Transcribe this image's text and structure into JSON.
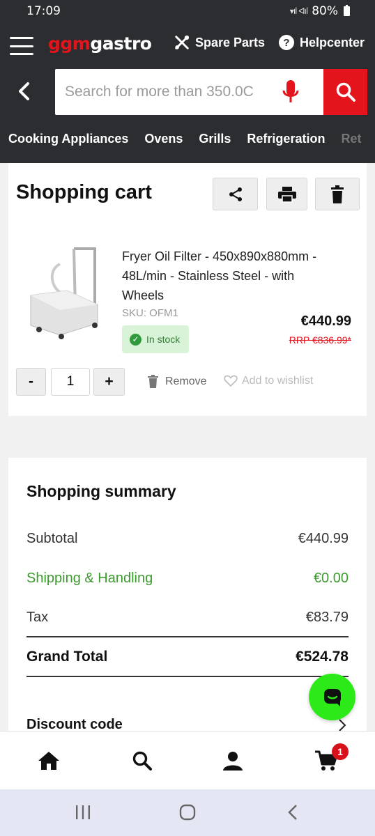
{
  "status_bar": {
    "time": "17:09",
    "battery": "80%"
  },
  "header": {
    "logo_part1": "ggm",
    "logo_part2": "gastro",
    "spare_parts": "Spare Parts",
    "helpcenter": "Helpcenter",
    "search_placeholder": "Search for more than 350.0C",
    "categories": [
      "Cooking Appliances",
      "Ovens",
      "Grills",
      "Refrigeration",
      "Ret"
    ]
  },
  "cart": {
    "title": "Shopping cart",
    "product": {
      "name": "Fryer Oil Filter - 450x890x880mm - 48L/min - Stainless Steel - with Wheels",
      "sku": "SKU: OFM1",
      "stock": "In stock",
      "price": "€440.99",
      "rrp": "RRP €836.99*"
    },
    "quantity": "1",
    "minus_label": "-",
    "plus_label": "+",
    "remove_label": "Remove",
    "wishlist_label": "Add to wishlist"
  },
  "summary": {
    "title": "Shopping summary",
    "subtotal_label": "Subtotal",
    "subtotal_value": "€440.99",
    "shipping_label": "Shipping & Handling",
    "shipping_value": "€0.00",
    "tax_label": "Tax",
    "tax_value": "€83.79",
    "total_label": "Grand Total",
    "total_value": "€524.78",
    "discount_label": "Discount code"
  },
  "bottom_nav": {
    "cart_badge": "1"
  },
  "colors": {
    "brand_red": "#e3141c",
    "header_bg": "#2b2d30",
    "chat_green": "#2bea17",
    "shipping_green": "#3c9a2e"
  }
}
